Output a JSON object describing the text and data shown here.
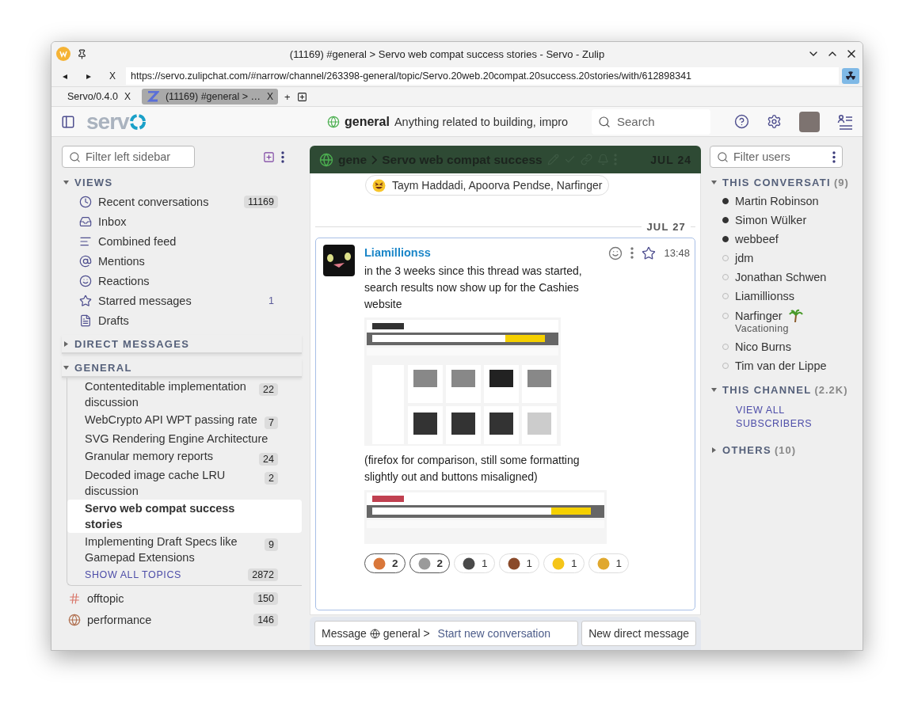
{
  "browser": {
    "title": "(11169) #general > Servo web compat success stories - Servo - Zulip",
    "nav": [
      "◂",
      "▸",
      "X"
    ],
    "url": "https://servo.zulipchat.com/#narrow/channel/263398-general/topic/Servo.20web.20compat.20success.20stories/with/612898341",
    "tabs": [
      {
        "label": "Servo/0.4.0",
        "close": "X",
        "selected": false
      },
      {
        "label": "(11169) #general > …",
        "close": "X",
        "selected": true
      }
    ],
    "new_tab": "+"
  },
  "header": {
    "logo": "serv",
    "channel": "general",
    "description": "Anything related to building, impro",
    "search": {
      "placeholder": "Search"
    }
  },
  "left_sidebar": {
    "filter": {
      "placeholder": "Filter left sidebar"
    },
    "views": {
      "title": "VIEWS",
      "expanded": true,
      "items": [
        {
          "kind": "clock",
          "label": "Recent conversations",
          "count": "11169",
          "badge": true
        },
        {
          "kind": "inbox",
          "label": "Inbox"
        },
        {
          "kind": "feed",
          "label": "Combined feed"
        },
        {
          "kind": "at",
          "label": "Mentions"
        },
        {
          "kind": "smile",
          "label": "Reactions"
        },
        {
          "kind": "star",
          "label": "Starred messages",
          "count": "1",
          "badge": false
        },
        {
          "kind": "file",
          "label": "Drafts"
        }
      ]
    },
    "direct_messages": {
      "title": "DIRECT MESSAGES",
      "expanded": false
    },
    "channel": {
      "title": "GENERAL",
      "expanded": true,
      "topics": [
        {
          "label": "Contenteditable implementation discussion",
          "count": "22",
          "selected": false
        },
        {
          "label": "WebCrypto API WPT passing rate",
          "count": "7",
          "selected": false
        },
        {
          "label": "SVG Rendering Engine Architecture",
          "selected": false
        },
        {
          "label": "Granular memory reports",
          "count": "24",
          "selected": false
        },
        {
          "label": "Decoded image cache LRU discussion",
          "count": "2",
          "selected": false
        },
        {
          "label": "Servo web compat success stories",
          "selected": true
        },
        {
          "label": "Implementing Draft Specs like Gamepad Extensions",
          "count": "9",
          "selected": false
        }
      ],
      "show_all": {
        "label": "SHOW ALL TOPICS",
        "count": "2872"
      }
    },
    "channels": [
      {
        "kind": "hash",
        "label": "offtopic",
        "count": "150"
      },
      {
        "kind": "globe",
        "label": "performance",
        "count": "146"
      }
    ]
  },
  "feed": {
    "recipient": {
      "channel": "gene",
      "topic": "Servo web compat success",
      "date": "JUL 24"
    },
    "prior_reaction": {
      "names": "Taym Haddadi, Apoorva Pendse, Narfinger"
    },
    "date_divider": "JUL 27",
    "message": {
      "sender": "Liamillionss",
      "time": "13:48",
      "paragraphs": [
        "in the 3 weeks since this thread was started, search results now show up for the Cashies website",
        "(firefox for comparison, still some formatting slightly out and buttons misaligned)"
      ],
      "reactions": [
        {
          "count": "2",
          "selected": true,
          "color": "#d9773a"
        },
        {
          "count": "2",
          "selected": true,
          "color": "#9a9a9a"
        },
        {
          "count": "1",
          "selected": false,
          "color": "#4a4a4a"
        },
        {
          "count": "1",
          "selected": false,
          "color": "#8a4a2a"
        },
        {
          "count": "1",
          "selected": false,
          "color": "#f5c518"
        },
        {
          "count": "1",
          "selected": false,
          "color": "#e0a82e"
        }
      ]
    },
    "compose": {
      "prefix": "Message",
      "channel": "general >",
      "start": "Start new conversation",
      "new_dm": "New direct message"
    }
  },
  "right_sidebar": {
    "filter": {
      "placeholder": "Filter users"
    },
    "conversation": {
      "title": "THIS CONVERSATI",
      "count": "(9)",
      "expanded": true,
      "users": [
        {
          "name": "Martin Robinson",
          "active": true
        },
        {
          "name": "Simon Wülker",
          "active": true
        },
        {
          "name": "webbeef",
          "active": true
        },
        {
          "name": "jdm",
          "active": false
        },
        {
          "name": "Jonathan Schwen",
          "active": false
        },
        {
          "name": "Liamillionss",
          "active": false
        },
        {
          "name": "Narfinger",
          "active": false,
          "status": "Vacationing",
          "status_emoji": true
        },
        {
          "name": "Nico Burns",
          "active": false
        },
        {
          "name": "Tim van der Lippe",
          "active": false
        }
      ]
    },
    "channel": {
      "title": "THIS CHANNEL",
      "count": "(2.2K)",
      "expanded": true,
      "link": "VIEW ALL SUBSCRIBERS"
    },
    "others": {
      "title": "OTHERS",
      "count": "(10)",
      "expanded": false
    }
  }
}
